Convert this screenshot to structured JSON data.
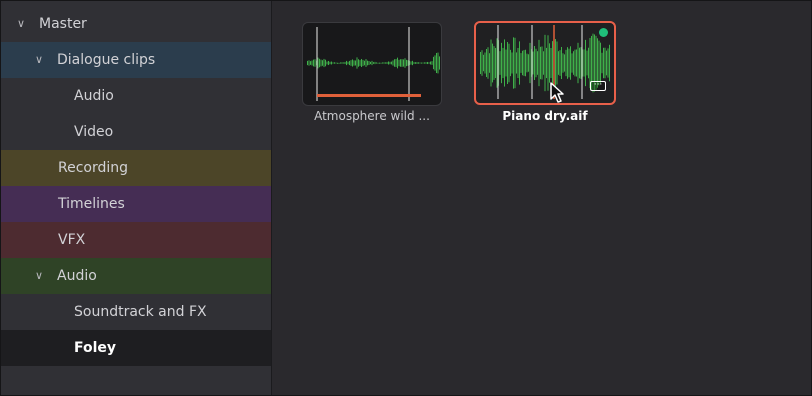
{
  "sidebar": {
    "items": [
      {
        "label": "Master",
        "expanded": true,
        "level": 0,
        "color": "#303035"
      },
      {
        "label": "Dialogue clips",
        "expanded": true,
        "level": 1,
        "color": "#2b3d4d"
      },
      {
        "label": "Audio",
        "level": 2,
        "color": "#303035"
      },
      {
        "label": "Video",
        "level": 2,
        "color": "#303035"
      },
      {
        "label": "Recording",
        "level": 1,
        "color": "#4c4528"
      },
      {
        "label": "Timelines",
        "level": 1,
        "color": "#452d54"
      },
      {
        "label": "VFX",
        "level": 1,
        "color": "#4d2b30"
      },
      {
        "label": "Audio",
        "expanded": true,
        "level": 1,
        "color": "#2f4326"
      },
      {
        "label": "Soundtrack and FX",
        "level": 2,
        "color": "#303035"
      },
      {
        "label": "Foley",
        "level": 2,
        "color": "#1e1e21",
        "selected": true
      }
    ]
  },
  "clips": [
    {
      "label": "Atmosphere wild ...",
      "selected": false
    },
    {
      "label": "Piano dry.aif",
      "selected": true
    }
  ],
  "colors": {
    "waveform": "#3fb04a",
    "playhead_marker": "#e0603a",
    "selection_border": "#e8604a",
    "status": "#1fbf7a"
  },
  "icons": {
    "collapse": "chevron-down-icon",
    "clip_menu": "more-options-icon",
    "cursor": "mouse-pointer-icon"
  }
}
